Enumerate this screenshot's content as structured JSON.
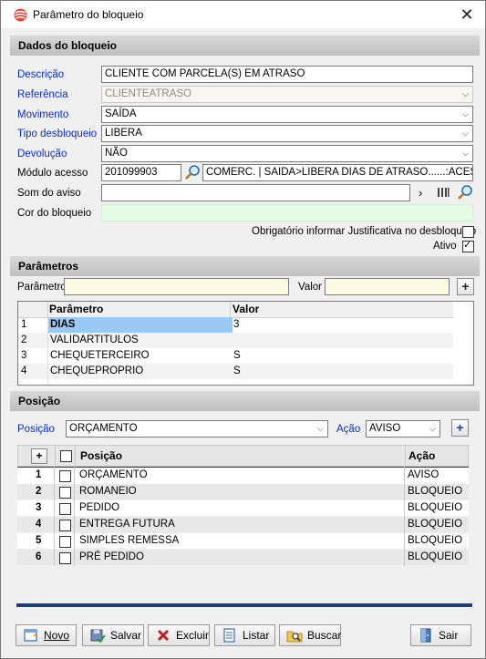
{
  "window": {
    "title": "Parâmetro do bloqueio",
    "close_glyph": "✕"
  },
  "dados": {
    "section_title": "Dados do bloqueio",
    "descricao_label": "Descrição",
    "descricao_value": "CLIENTE COM PARCELA(S) EM ATRASO",
    "referencia_label": "Referência",
    "referencia_value": "CLIENTEATRASO",
    "movimento_label": "Movimento",
    "movimento_value": "SAÍDA",
    "tipo_label": "Tipo desbloqueio",
    "tipo_value": "LIBERA",
    "devolucao_label": "Devolução",
    "devolucao_value": "NÃO",
    "modulo_label": "Módulo acesso",
    "modulo_code": "201099903",
    "modulo_desc": "COMERC. | SAIDA>LIBERA DIAS DE ATRASO......:ACESSAR",
    "som_label": "Som do aviso",
    "som_value": "",
    "cor_label": "Cor do bloqueio",
    "cor_color": "#e4fbe4",
    "obrigatorio_label": "Obrigatório informar Justificativa no desbloqueio",
    "obrigatorio_checked": false,
    "ativo_label": "Ativo",
    "ativo_checked": true
  },
  "parametros": {
    "section_title": "Parâmetros",
    "parametro_label": "Parâmetro",
    "parametro_value": "",
    "valor_label": "Valor",
    "valor_value": "",
    "columns": [
      "Parâmetro",
      "Valor"
    ],
    "rows": [
      {
        "n": "1",
        "param": "DIAS",
        "valor": "3"
      },
      {
        "n": "2",
        "param": "VALIDARTITULOS",
        "valor": ""
      },
      {
        "n": "3",
        "param": "CHEQUETERCEIRO",
        "valor": "S"
      },
      {
        "n": "4",
        "param": "CHEQUEPROPRIO",
        "valor": "S"
      }
    ]
  },
  "posicao": {
    "section_title": "Posição",
    "posicao_label": "Posição",
    "posicao_value": "ORÇAMENTO",
    "acao_label": "Ação",
    "acao_value": "AVISO",
    "columns": [
      "Posição",
      "Ação"
    ],
    "header_plus": "+",
    "rows": [
      {
        "n": "1",
        "pos": "ORÇAMENTO",
        "acao": "AVISO"
      },
      {
        "n": "2",
        "pos": "ROMANEIO",
        "acao": "BLOQUEIO"
      },
      {
        "n": "3",
        "pos": "PEDIDO",
        "acao": "BLOQUEIO"
      },
      {
        "n": "4",
        "pos": "ENTREGA FUTURA",
        "acao": "BLOQUEIO"
      },
      {
        "n": "5",
        "pos": "SIMPLES REMESSA",
        "acao": "BLOQUEIO"
      },
      {
        "n": "6",
        "pos": "PRÉ PEDIDO",
        "acao": "BLOQUEIO"
      }
    ]
  },
  "toolbar": {
    "novo": "Novo",
    "salvar": "Salvar",
    "excluir": "Excluir",
    "listar": "Listar",
    "buscar": "Buscar",
    "sair": "Sair"
  },
  "colors": {
    "accent_blue": "#0a2bd6",
    "selection": "#9ac9f5",
    "progress": "#1e3f6e"
  }
}
